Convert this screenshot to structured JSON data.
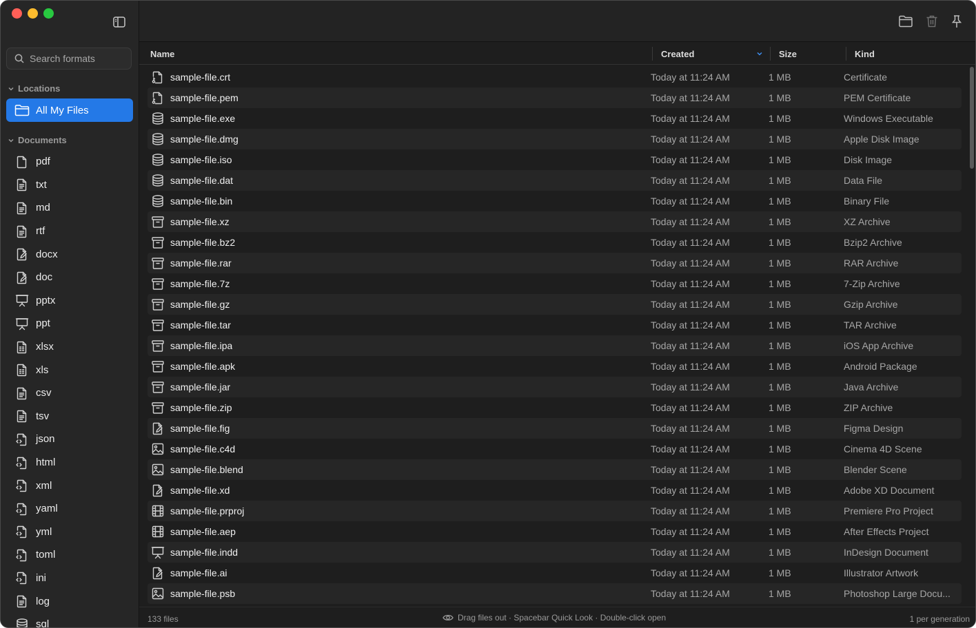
{
  "sidebar": {
    "search_placeholder": "Search formats",
    "locations_label": "Locations",
    "all_files_label": "All My Files",
    "documents_label": "Documents",
    "formats": [
      {
        "label": "pdf",
        "icon": "doc"
      },
      {
        "label": "txt",
        "icon": "doc-text"
      },
      {
        "label": "md",
        "icon": "doc-text"
      },
      {
        "label": "rtf",
        "icon": "doc-text"
      },
      {
        "label": "docx",
        "icon": "doc-pen"
      },
      {
        "label": "doc",
        "icon": "doc-pen"
      },
      {
        "label": "pptx",
        "icon": "presentation"
      },
      {
        "label": "ppt",
        "icon": "presentation"
      },
      {
        "label": "xlsx",
        "icon": "doc-sheet"
      },
      {
        "label": "xls",
        "icon": "doc-sheet"
      },
      {
        "label": "csv",
        "icon": "doc-text"
      },
      {
        "label": "tsv",
        "icon": "doc-text"
      },
      {
        "label": "json",
        "icon": "doc-code"
      },
      {
        "label": "html",
        "icon": "doc-code"
      },
      {
        "label": "xml",
        "icon": "doc-code"
      },
      {
        "label": "yaml",
        "icon": "doc-code"
      },
      {
        "label": "yml",
        "icon": "doc-code"
      },
      {
        "label": "toml",
        "icon": "doc-code"
      },
      {
        "label": "ini",
        "icon": "doc-code"
      },
      {
        "label": "log",
        "icon": "doc-text"
      },
      {
        "label": "sql",
        "icon": "database"
      }
    ]
  },
  "columns": {
    "name": "Name",
    "created": "Created",
    "size": "Size",
    "kind": "Kind"
  },
  "files": [
    {
      "name": "sample-file.crt",
      "created": "Today at 11:24 AM",
      "size": "1 MB",
      "kind": "Certificate",
      "icon": "doc-key"
    },
    {
      "name": "sample-file.pem",
      "created": "Today at 11:24 AM",
      "size": "1 MB",
      "kind": "PEM Certificate",
      "icon": "doc-key"
    },
    {
      "name": "sample-file.exe",
      "created": "Today at 11:24 AM",
      "size": "1 MB",
      "kind": "Windows Executable",
      "icon": "database"
    },
    {
      "name": "sample-file.dmg",
      "created": "Today at 11:24 AM",
      "size": "1 MB",
      "kind": "Apple Disk Image",
      "icon": "database"
    },
    {
      "name": "sample-file.iso",
      "created": "Today at 11:24 AM",
      "size": "1 MB",
      "kind": "Disk Image",
      "icon": "database"
    },
    {
      "name": "sample-file.dat",
      "created": "Today at 11:24 AM",
      "size": "1 MB",
      "kind": "Data File",
      "icon": "database"
    },
    {
      "name": "sample-file.bin",
      "created": "Today at 11:24 AM",
      "size": "1 MB",
      "kind": "Binary File",
      "icon": "database"
    },
    {
      "name": "sample-file.xz",
      "created": "Today at 11:24 AM",
      "size": "1 MB",
      "kind": "XZ Archive",
      "icon": "archive"
    },
    {
      "name": "sample-file.bz2",
      "created": "Today at 11:24 AM",
      "size": "1 MB",
      "kind": "Bzip2 Archive",
      "icon": "archive"
    },
    {
      "name": "sample-file.rar",
      "created": "Today at 11:24 AM",
      "size": "1 MB",
      "kind": "RAR Archive",
      "icon": "archive"
    },
    {
      "name": "sample-file.7z",
      "created": "Today at 11:24 AM",
      "size": "1 MB",
      "kind": "7-Zip Archive",
      "icon": "archive"
    },
    {
      "name": "sample-file.gz",
      "created": "Today at 11:24 AM",
      "size": "1 MB",
      "kind": "Gzip Archive",
      "icon": "archive"
    },
    {
      "name": "sample-file.tar",
      "created": "Today at 11:24 AM",
      "size": "1 MB",
      "kind": "TAR Archive",
      "icon": "archive"
    },
    {
      "name": "sample-file.ipa",
      "created": "Today at 11:24 AM",
      "size": "1 MB",
      "kind": "iOS App Archive",
      "icon": "archive"
    },
    {
      "name": "sample-file.apk",
      "created": "Today at 11:24 AM",
      "size": "1 MB",
      "kind": "Android Package",
      "icon": "archive"
    },
    {
      "name": "sample-file.jar",
      "created": "Today at 11:24 AM",
      "size": "1 MB",
      "kind": "Java Archive",
      "icon": "archive"
    },
    {
      "name": "sample-file.zip",
      "created": "Today at 11:24 AM",
      "size": "1 MB",
      "kind": "ZIP Archive",
      "icon": "archive"
    },
    {
      "name": "sample-file.fig",
      "created": "Today at 11:24 AM",
      "size": "1 MB",
      "kind": "Figma Design",
      "icon": "doc-pen"
    },
    {
      "name": "sample-file.c4d",
      "created": "Today at 11:24 AM",
      "size": "1 MB",
      "kind": "Cinema 4D Scene",
      "icon": "image"
    },
    {
      "name": "sample-file.blend",
      "created": "Today at 11:24 AM",
      "size": "1 MB",
      "kind": "Blender Scene",
      "icon": "image"
    },
    {
      "name": "sample-file.xd",
      "created": "Today at 11:24 AM",
      "size": "1 MB",
      "kind": "Adobe XD Document",
      "icon": "doc-pen"
    },
    {
      "name": "sample-file.prproj",
      "created": "Today at 11:24 AM",
      "size": "1 MB",
      "kind": "Premiere Pro Project",
      "icon": "film"
    },
    {
      "name": "sample-file.aep",
      "created": "Today at 11:24 AM",
      "size": "1 MB",
      "kind": "After Effects Project",
      "icon": "film"
    },
    {
      "name": "sample-file.indd",
      "created": "Today at 11:24 AM",
      "size": "1 MB",
      "kind": "InDesign Document",
      "icon": "presentation"
    },
    {
      "name": "sample-file.ai",
      "created": "Today at 11:24 AM",
      "size": "1 MB",
      "kind": "Illustrator Artwork",
      "icon": "doc-pen"
    },
    {
      "name": "sample-file.psb",
      "created": "Today at 11:24 AM",
      "size": "1 MB",
      "kind": "Photoshop Large Docu...",
      "icon": "image"
    }
  ],
  "status": {
    "count": "133 files",
    "hint": "Drag files out · Spacebar Quick Look · Double-click open",
    "right": "1 per generation"
  },
  "colors": {
    "accent": "#2479e7",
    "close": "#ff5f57",
    "minimize": "#febc2e",
    "zoom": "#28c840"
  }
}
